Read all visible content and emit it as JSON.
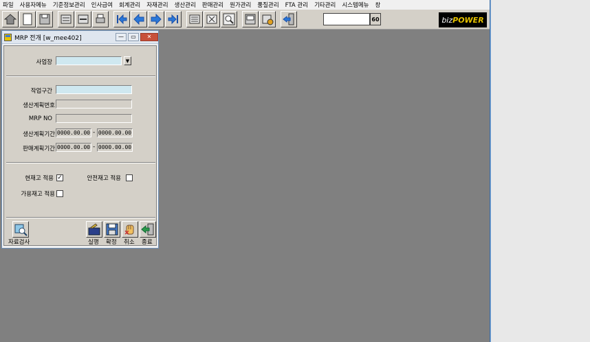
{
  "menu": [
    "파일",
    "사용자메뉴",
    "기준정보관리",
    "인사급여",
    "회계관리",
    "자재관리",
    "생산관리",
    "판매관리",
    "원가관리",
    "품질관리",
    "FTA 관리",
    "기타관리",
    "시스템메뉴",
    "창"
  ],
  "toolbar": {
    "zoom_value": "60",
    "brand_prefix": "biz",
    "brand_suffix": "POWER"
  },
  "window": {
    "title": "MRP 전개 [w_mee402]",
    "minimize": "—",
    "restore": "▭",
    "close": "✕"
  },
  "form": {
    "business_site_label": "사업장",
    "business_site_value": "",
    "work_section_label": "작업구간",
    "work_section_value": "",
    "plan_no_label": "생산계획번호",
    "plan_no_value": "",
    "mrp_no_label": "MRP NO",
    "mrp_no_value": "",
    "plan_period_label": "생산계획기간",
    "plan_period_from": "0000.00.00",
    "plan_period_to": "0000.00.00",
    "sales_period_label": "판매계획기간",
    "sales_period_from": "0000.00.00",
    "sales_period_to": "0000.00.00",
    "dash": "-",
    "current_stock_label": "현재고 적용",
    "current_stock_checked": "✓",
    "safety_stock_label": "안전재고 적용",
    "safety_stock_checked": "",
    "available_stock_label": "가용재고 적용",
    "available_stock_checked": ""
  },
  "buttons": {
    "data_check": "자료검사",
    "run": "실행",
    "confirm": "확정",
    "cancel": "취소",
    "exit": "종료"
  }
}
